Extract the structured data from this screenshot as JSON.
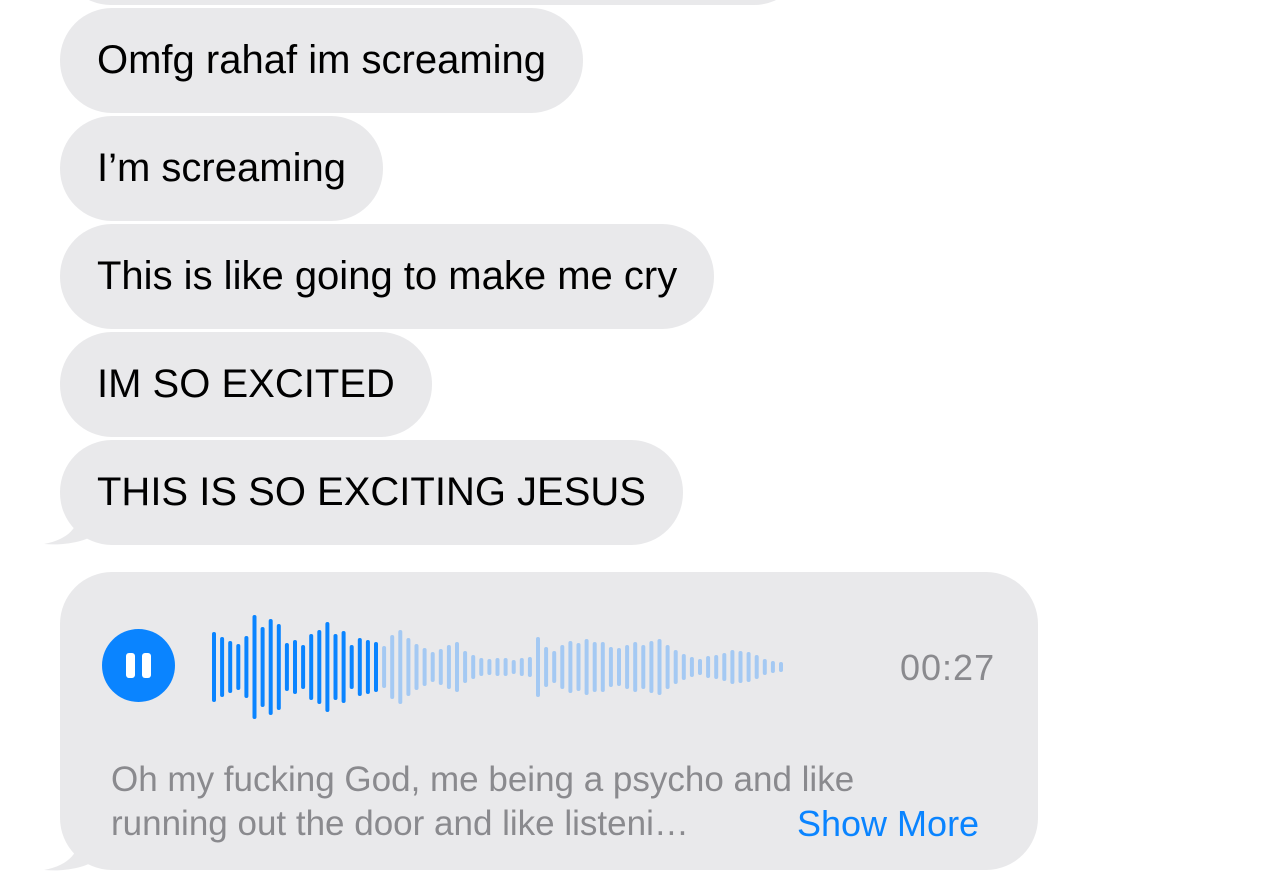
{
  "messages": [
    {
      "text": "Omfg rahaf im screaming"
    },
    {
      "text": "I’m screaming"
    },
    {
      "text": "This is like going to make me cry"
    },
    {
      "text": "IM SO EXCITED"
    },
    {
      "text": "THIS IS SO EXCITING JESUS"
    }
  ],
  "voice_message": {
    "duration": "00:27",
    "playback_state": "playing",
    "transcript_line1": "Oh my fucking God, me being a psycho and like",
    "transcript_line2": "running out the door and like listeni…",
    "show_more_label": "Show More"
  },
  "colors": {
    "bubble_bg": "#e9e9eb",
    "accent": "#0a84ff",
    "waveform_played": "#0a84ff",
    "waveform_unplayed": "#a4c9f3",
    "secondary_text": "#8a8a8e"
  },
  "icons": {
    "play_button": "pause-icon"
  }
}
